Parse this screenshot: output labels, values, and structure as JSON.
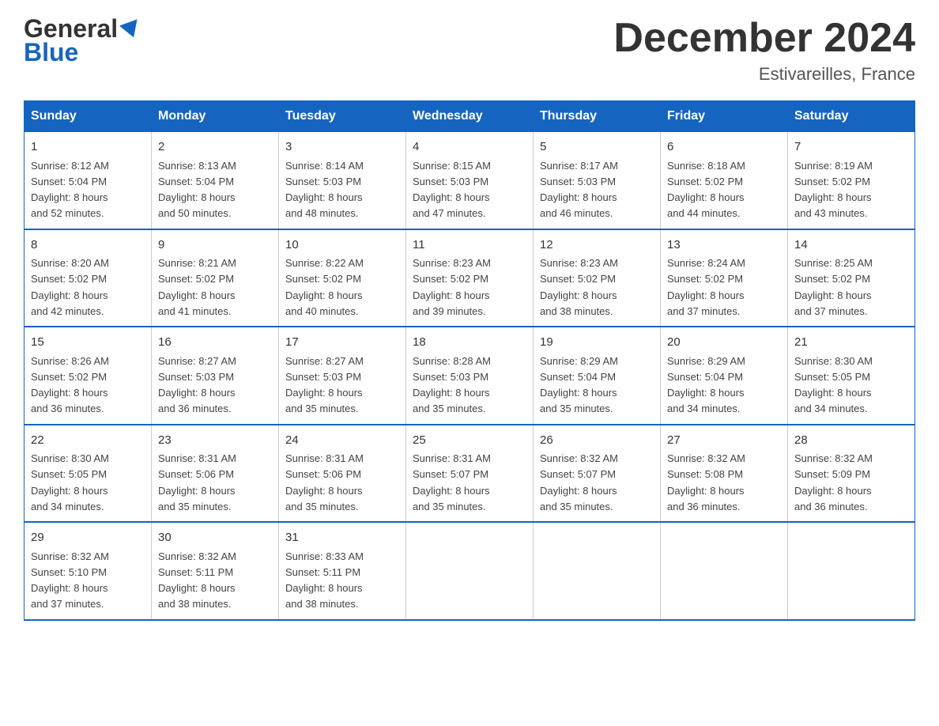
{
  "header": {
    "logo_general": "General",
    "logo_blue": "Blue",
    "title": "December 2024",
    "subtitle": "Estivareilles, France"
  },
  "days_of_week": [
    "Sunday",
    "Monday",
    "Tuesday",
    "Wednesday",
    "Thursday",
    "Friday",
    "Saturday"
  ],
  "weeks": [
    [
      {
        "day": "1",
        "sunrise": "8:12 AM",
        "sunset": "5:04 PM",
        "daylight": "8 hours and 52 minutes."
      },
      {
        "day": "2",
        "sunrise": "8:13 AM",
        "sunset": "5:04 PM",
        "daylight": "8 hours and 50 minutes."
      },
      {
        "day": "3",
        "sunrise": "8:14 AM",
        "sunset": "5:03 PM",
        "daylight": "8 hours and 48 minutes."
      },
      {
        "day": "4",
        "sunrise": "8:15 AM",
        "sunset": "5:03 PM",
        "daylight": "8 hours and 47 minutes."
      },
      {
        "day": "5",
        "sunrise": "8:17 AM",
        "sunset": "5:03 PM",
        "daylight": "8 hours and 46 minutes."
      },
      {
        "day": "6",
        "sunrise": "8:18 AM",
        "sunset": "5:02 PM",
        "daylight": "8 hours and 44 minutes."
      },
      {
        "day": "7",
        "sunrise": "8:19 AM",
        "sunset": "5:02 PM",
        "daylight": "8 hours and 43 minutes."
      }
    ],
    [
      {
        "day": "8",
        "sunrise": "8:20 AM",
        "sunset": "5:02 PM",
        "daylight": "8 hours and 42 minutes."
      },
      {
        "day": "9",
        "sunrise": "8:21 AM",
        "sunset": "5:02 PM",
        "daylight": "8 hours and 41 minutes."
      },
      {
        "day": "10",
        "sunrise": "8:22 AM",
        "sunset": "5:02 PM",
        "daylight": "8 hours and 40 minutes."
      },
      {
        "day": "11",
        "sunrise": "8:23 AM",
        "sunset": "5:02 PM",
        "daylight": "8 hours and 39 minutes."
      },
      {
        "day": "12",
        "sunrise": "8:23 AM",
        "sunset": "5:02 PM",
        "daylight": "8 hours and 38 minutes."
      },
      {
        "day": "13",
        "sunrise": "8:24 AM",
        "sunset": "5:02 PM",
        "daylight": "8 hours and 37 minutes."
      },
      {
        "day": "14",
        "sunrise": "8:25 AM",
        "sunset": "5:02 PM",
        "daylight": "8 hours and 37 minutes."
      }
    ],
    [
      {
        "day": "15",
        "sunrise": "8:26 AM",
        "sunset": "5:02 PM",
        "daylight": "8 hours and 36 minutes."
      },
      {
        "day": "16",
        "sunrise": "8:27 AM",
        "sunset": "5:03 PM",
        "daylight": "8 hours and 36 minutes."
      },
      {
        "day": "17",
        "sunrise": "8:27 AM",
        "sunset": "5:03 PM",
        "daylight": "8 hours and 35 minutes."
      },
      {
        "day": "18",
        "sunrise": "8:28 AM",
        "sunset": "5:03 PM",
        "daylight": "8 hours and 35 minutes."
      },
      {
        "day": "19",
        "sunrise": "8:29 AM",
        "sunset": "5:04 PM",
        "daylight": "8 hours and 35 minutes."
      },
      {
        "day": "20",
        "sunrise": "8:29 AM",
        "sunset": "5:04 PM",
        "daylight": "8 hours and 34 minutes."
      },
      {
        "day": "21",
        "sunrise": "8:30 AM",
        "sunset": "5:05 PM",
        "daylight": "8 hours and 34 minutes."
      }
    ],
    [
      {
        "day": "22",
        "sunrise": "8:30 AM",
        "sunset": "5:05 PM",
        "daylight": "8 hours and 34 minutes."
      },
      {
        "day": "23",
        "sunrise": "8:31 AM",
        "sunset": "5:06 PM",
        "daylight": "8 hours and 35 minutes."
      },
      {
        "day": "24",
        "sunrise": "8:31 AM",
        "sunset": "5:06 PM",
        "daylight": "8 hours and 35 minutes."
      },
      {
        "day": "25",
        "sunrise": "8:31 AM",
        "sunset": "5:07 PM",
        "daylight": "8 hours and 35 minutes."
      },
      {
        "day": "26",
        "sunrise": "8:32 AM",
        "sunset": "5:07 PM",
        "daylight": "8 hours and 35 minutes."
      },
      {
        "day": "27",
        "sunrise": "8:32 AM",
        "sunset": "5:08 PM",
        "daylight": "8 hours and 36 minutes."
      },
      {
        "day": "28",
        "sunrise": "8:32 AM",
        "sunset": "5:09 PM",
        "daylight": "8 hours and 36 minutes."
      }
    ],
    [
      {
        "day": "29",
        "sunrise": "8:32 AM",
        "sunset": "5:10 PM",
        "daylight": "8 hours and 37 minutes."
      },
      {
        "day": "30",
        "sunrise": "8:32 AM",
        "sunset": "5:11 PM",
        "daylight": "8 hours and 38 minutes."
      },
      {
        "day": "31",
        "sunrise": "8:33 AM",
        "sunset": "5:11 PM",
        "daylight": "8 hours and 38 minutes."
      },
      {
        "day": "",
        "sunrise": "",
        "sunset": "",
        "daylight": ""
      },
      {
        "day": "",
        "sunrise": "",
        "sunset": "",
        "daylight": ""
      },
      {
        "day": "",
        "sunrise": "",
        "sunset": "",
        "daylight": ""
      },
      {
        "day": "",
        "sunrise": "",
        "sunset": "",
        "daylight": ""
      }
    ]
  ],
  "labels": {
    "sunrise_prefix": "Sunrise: ",
    "sunset_prefix": "Sunset: ",
    "daylight_prefix": "Daylight: "
  }
}
